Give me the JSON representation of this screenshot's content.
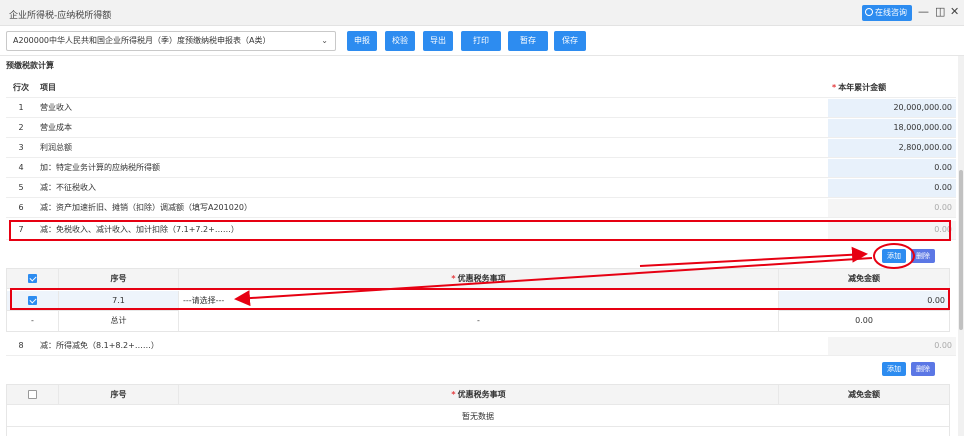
{
  "window": {
    "title": "企业所得税-应纳税所得额",
    "consult_label": "在线咨询",
    "min_glyph": "—",
    "restore_glyph": "◫",
    "close_glyph": "✕"
  },
  "toolbar": {
    "form_select": "A200000中华人民共和国企业所得税月（季）度预缴纳税申报表（A类）",
    "buttons": [
      "申报",
      "校验",
      "导出",
      "打印",
      "暂存",
      "保存"
    ]
  },
  "section": {
    "title": "预缴税款计算",
    "col_index": "行次",
    "col_item": "项目",
    "col_amount": "本年累计金额",
    "rows": [
      {
        "idx": "1",
        "label": "营业收入",
        "amount": "20,000,000.00"
      },
      {
        "idx": "2",
        "label": "营业成本",
        "amount": "18,000,000.00"
      },
      {
        "idx": "3",
        "label": "利润总额",
        "amount": "2,800,000.00"
      },
      {
        "idx": "4",
        "label": "加：特定业务计算的应纳税所得额",
        "amount": "0.00"
      },
      {
        "idx": "5",
        "label": "减：不征税收入",
        "amount": "0.00"
      },
      {
        "idx": "6",
        "label": "减：资产加速折旧、摊销（扣除）调减额（填写A201020）",
        "amount": "0.00"
      },
      {
        "idx": "7",
        "label": "减：免税收入、减计收入、加计扣除（7.1+7.2+……）",
        "amount": "0.00"
      }
    ],
    "row8": {
      "idx": "8",
      "label": "减：所得减免（8.1+8.2+……）",
      "amount": "0.00"
    }
  },
  "subtable1": {
    "add_label": "添加",
    "del_label": "删除",
    "col_seq": "序号",
    "col_item": "优惠税务事项",
    "col_amount": "减免金额",
    "row": {
      "seq": "7.1",
      "item": "---请选择---",
      "amount": "0.00"
    },
    "total": {
      "dash": "-",
      "label": "总计",
      "item": "-",
      "amount": "0.00"
    }
  },
  "subtable2": {
    "add_label": "添加",
    "del_label": "删除",
    "col_seq": "序号",
    "col_item": "优惠税务事项",
    "col_amount": "减免金额",
    "empty_text": "暂无数据"
  },
  "colors": {
    "primary": "#2d8cf0",
    "annotation": "#e60012",
    "input_bg": "#e8f1fb"
  }
}
